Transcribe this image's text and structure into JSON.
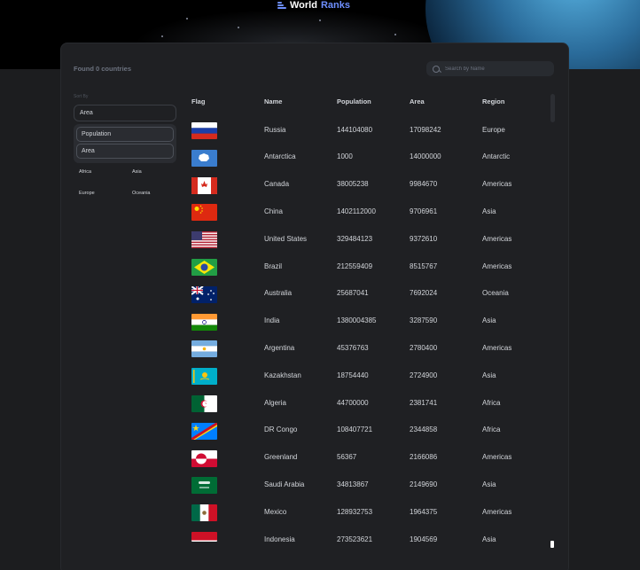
{
  "app": {
    "title_world": "World",
    "title_ranks": "Ranks"
  },
  "summary": {
    "found": "Found 0 countries"
  },
  "search": {
    "placeholder": "Search by Name"
  },
  "sort": {
    "label": "Sort By",
    "selected": "Area",
    "options": [
      "Population",
      "Area"
    ]
  },
  "regions": [
    "Africa",
    "Asia",
    "Europe",
    "Oceania"
  ],
  "table": {
    "headers": [
      "Flag",
      "Name",
      "Population",
      "Area",
      "Region"
    ],
    "rows": [
      {
        "flag": "russia",
        "name": "Russia",
        "population": "144104080",
        "area": "17098242",
        "region": "Europe"
      },
      {
        "flag": "antarctica",
        "name": "Antarctica",
        "population": "1000",
        "area": "14000000",
        "region": "Antarctic"
      },
      {
        "flag": "canada",
        "name": "Canada",
        "population": "38005238",
        "area": "9984670",
        "region": "Americas"
      },
      {
        "flag": "china",
        "name": "China",
        "population": "1402112000",
        "area": "9706961",
        "region": "Asia"
      },
      {
        "flag": "united-states",
        "name": "United States",
        "population": "329484123",
        "area": "9372610",
        "region": "Americas"
      },
      {
        "flag": "brazil",
        "name": "Brazil",
        "population": "212559409",
        "area": "8515767",
        "region": "Americas"
      },
      {
        "flag": "australia",
        "name": "Australia",
        "population": "25687041",
        "area": "7692024",
        "region": "Oceania"
      },
      {
        "flag": "india",
        "name": "India",
        "population": "1380004385",
        "area": "3287590",
        "region": "Asia"
      },
      {
        "flag": "argentina",
        "name": "Argentina",
        "population": "45376763",
        "area": "2780400",
        "region": "Americas"
      },
      {
        "flag": "kazakhstan",
        "name": "Kazakhstan",
        "population": "18754440",
        "area": "2724900",
        "region": "Asia"
      },
      {
        "flag": "algeria",
        "name": "Algeria",
        "population": "44700000",
        "area": "2381741",
        "region": "Africa"
      },
      {
        "flag": "dr-congo",
        "name": "DR Congo",
        "population": "108407721",
        "area": "2344858",
        "region": "Africa"
      },
      {
        "flag": "greenland",
        "name": "Greenland",
        "population": "56367",
        "area": "2166086",
        "region": "Americas"
      },
      {
        "flag": "saudi-arabia",
        "name": "Saudi Arabia",
        "population": "34813867",
        "area": "2149690",
        "region": "Asia"
      },
      {
        "flag": "mexico",
        "name": "Mexico",
        "population": "128932753",
        "area": "1964375",
        "region": "Americas"
      },
      {
        "flag": "indonesia",
        "name": "Indonesia",
        "population": "273523621",
        "area": "1904569",
        "region": "Asia"
      }
    ]
  },
  "colors": {
    "accent": "#6e8fff",
    "background": "#1c1d1f",
    "card": "#1f2023",
    "text": "#d2d5da",
    "muted": "#6c727f"
  }
}
